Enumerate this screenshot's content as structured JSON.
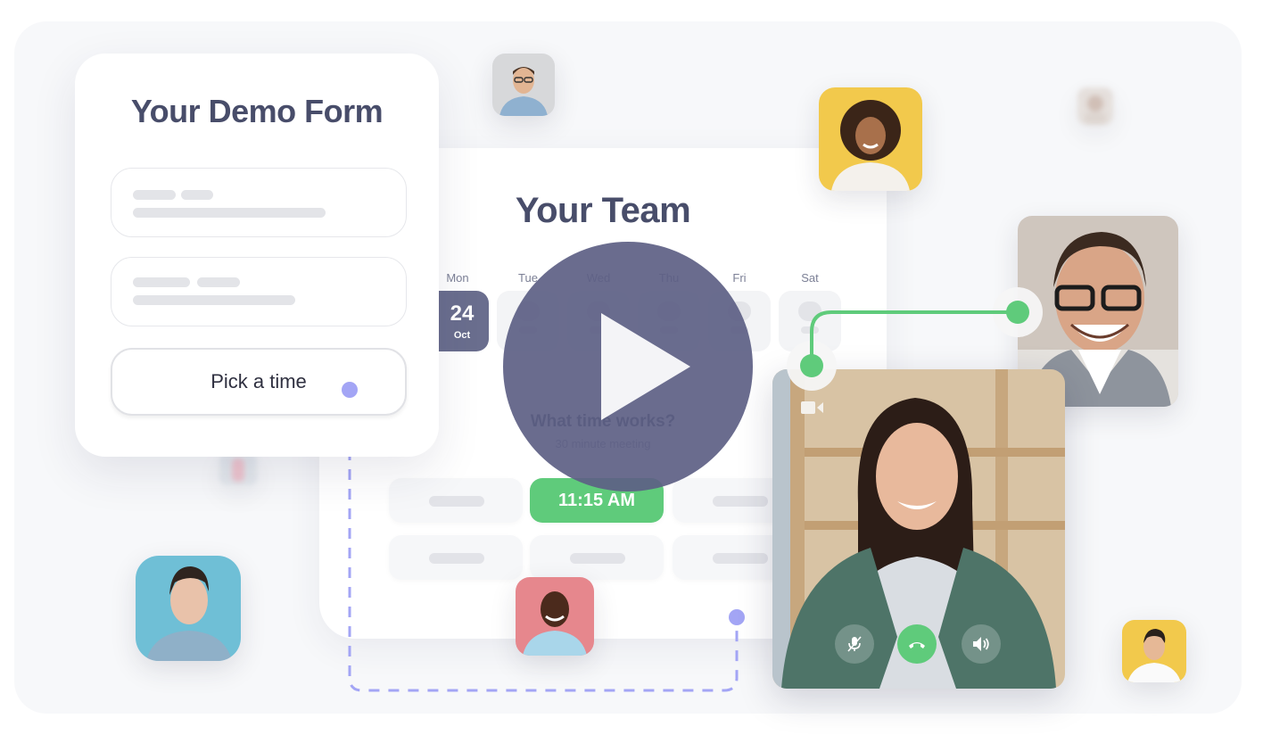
{
  "demo_form": {
    "title": "Your Demo Form",
    "fields": [
      {
        "name": "field-1",
        "placeholder_bars": 3
      },
      {
        "name": "field-2",
        "placeholder_bars": 3
      }
    ],
    "cta_label": "Pick a time"
  },
  "team_card": {
    "title": "Your Team",
    "days": [
      {
        "label": "Mon",
        "selected": true,
        "date": "24",
        "month": "Oct"
      },
      {
        "label": "Tue",
        "selected": false
      },
      {
        "label": "Wed",
        "selected": false
      },
      {
        "label": "Thu",
        "selected": false
      },
      {
        "label": "Fri",
        "selected": false
      },
      {
        "label": "Sat",
        "selected": false
      }
    ],
    "question": "What time works?",
    "meeting_length": "30 minute meeting",
    "selected_slot": "11:15 AM"
  },
  "video_call": {
    "controls": [
      {
        "name": "mute-microphone",
        "icon": "mic-off-icon"
      },
      {
        "name": "end-call",
        "icon": "phone-hangup-icon"
      },
      {
        "name": "speaker",
        "icon": "speaker-icon"
      }
    ]
  },
  "play_button": {
    "icon": "play-icon"
  },
  "colors": {
    "title": "#484d6a",
    "accent_green": "#5fcb7b",
    "connector_purple": "#a3a5f5",
    "selected_day": "#6a6e8e",
    "play_overlay": "#5d6084"
  }
}
